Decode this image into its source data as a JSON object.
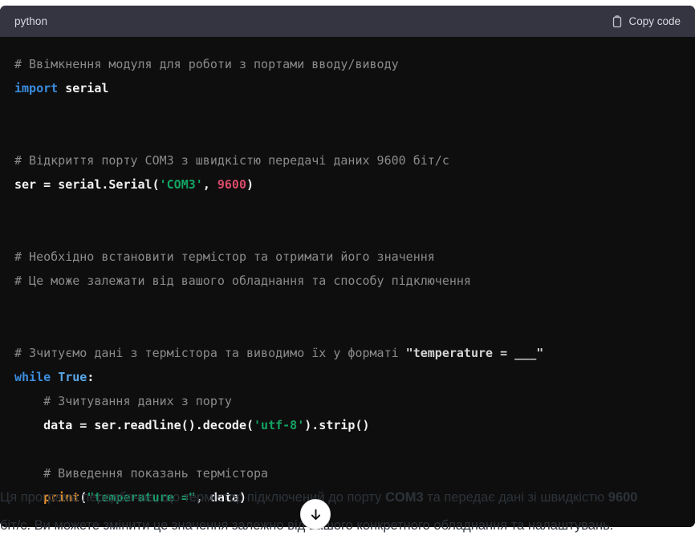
{
  "code_block": {
    "language_label": "python",
    "copy_label": "Copy code",
    "copy_icon": "clipboard-icon",
    "lines": [
      {
        "tokens": [
          {
            "t": "# Ввімкнення модуля для роботи з портами вводу/виводу",
            "c": "tok-comment"
          }
        ]
      },
      {
        "tokens": [
          {
            "t": "import",
            "c": "tok-kw"
          },
          {
            "t": " ",
            "c": "tok-plain"
          },
          {
            "t": "serial",
            "c": "tok-plain"
          }
        ]
      },
      {
        "tokens": []
      },
      {
        "tokens": []
      },
      {
        "tokens": [
          {
            "t": "# Відкриття порту COM3 з швидкістю передачі даних 9600 біт/с",
            "c": "tok-comment"
          }
        ]
      },
      {
        "tokens": [
          {
            "t": "ser",
            "c": "tok-plain"
          },
          {
            "t": " = ",
            "c": "tok-punc"
          },
          {
            "t": "serial.Serial(",
            "c": "tok-plain"
          },
          {
            "t": "'COM3'",
            "c": "tok-str"
          },
          {
            "t": ", ",
            "c": "tok-punc"
          },
          {
            "t": "9600",
            "c": "tok-num"
          },
          {
            "t": ")",
            "c": "tok-punc"
          }
        ]
      },
      {
        "tokens": []
      },
      {
        "tokens": []
      },
      {
        "tokens": [
          {
            "t": "# Необхідно встановити термістор та отримати його значення",
            "c": "tok-comment"
          }
        ]
      },
      {
        "tokens": [
          {
            "t": "# Це може залежати від вашого обладнання та способу підключення",
            "c": "tok-comment"
          }
        ]
      },
      {
        "tokens": []
      },
      {
        "tokens": []
      },
      {
        "tokens": [
          {
            "t": "# Зчитуємо дані з термістора та виводимо їх у форматі ",
            "c": "tok-comment"
          },
          {
            "t": "\"temperature = ___\"",
            "c": "tok-comment-b"
          }
        ]
      },
      {
        "tokens": [
          {
            "t": "while",
            "c": "tok-kw"
          },
          {
            "t": " ",
            "c": "tok-plain"
          },
          {
            "t": "True",
            "c": "tok-const"
          },
          {
            "t": ":",
            "c": "tok-punc"
          }
        ]
      },
      {
        "tokens": [
          {
            "t": "    # Зчитування даних з порту",
            "c": "tok-comment"
          }
        ]
      },
      {
        "tokens": [
          {
            "t": "    data",
            "c": "tok-plain"
          },
          {
            "t": " = ",
            "c": "tok-punc"
          },
          {
            "t": "ser.readline().decode(",
            "c": "tok-plain"
          },
          {
            "t": "'utf-8'",
            "c": "tok-str"
          },
          {
            "t": ").strip()",
            "c": "tok-plain"
          }
        ]
      },
      {
        "tokens": []
      },
      {
        "tokens": [
          {
            "t": "    # Виведення показань термістора",
            "c": "tok-comment"
          }
        ]
      },
      {
        "tokens": [
          {
            "t": "    ",
            "c": "tok-plain"
          },
          {
            "t": "print",
            "c": "tok-fn"
          },
          {
            "t": "(",
            "c": "tok-punc"
          },
          {
            "t": "\"temperature =\"",
            "c": "tok-str2"
          },
          {
            "t": ", ",
            "c": "tok-punc"
          },
          {
            "t": "data",
            "c": "tok-plain"
          },
          {
            "t": ")",
            "c": "tok-punc"
          }
        ]
      }
    ]
  },
  "prose": {
    "segments": [
      {
        "t": "Ця програма передбачає, що термістор підключений до порту ",
        "b": false
      },
      {
        "t": "COM3",
        "b": true
      },
      {
        "t": " та передає дані зі швидкістю ",
        "b": false
      },
      {
        "t": "9600",
        "b": true
      },
      {
        "t": " біт/с. Ви можете змінити це значення залежно від вашого конкретного обладнання та налаштувань.",
        "b": false
      }
    ]
  },
  "scroll_button": {
    "icon": "arrow-down-icon",
    "label": "scroll to bottom"
  },
  "colors": {
    "header_bg": "#343541",
    "code_bg": "#0e0e0e",
    "page_bg": "#ffffff",
    "comment": "#8b8b8b",
    "keyword": "#3b8ddd",
    "string": "#13a463",
    "number": "#d94a6a",
    "function": "#e8912d",
    "text": "#f2f2f2",
    "prose_text": "#2d333a"
  }
}
